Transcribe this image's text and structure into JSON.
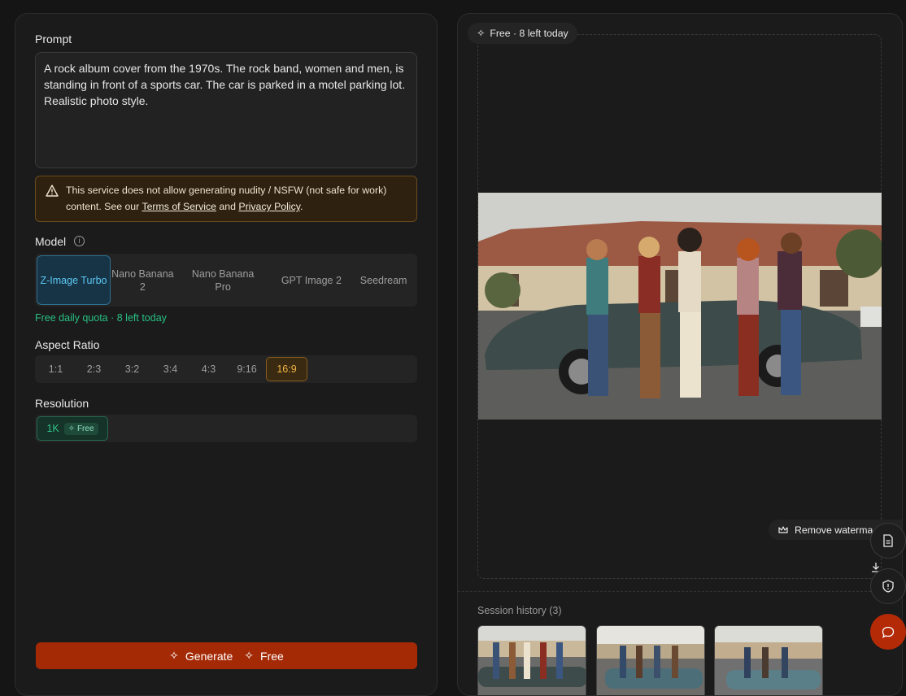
{
  "prompt": {
    "label": "Prompt",
    "value": "A rock album cover from the 1970s. The rock band, women and men, is standing in front of a sports car. The car is parked in a motel parking lot. Realistic photo style."
  },
  "warning": {
    "text_before": "This service does not allow generating nudity / NSFW (not safe for work) content. See our ",
    "terms_link": "Terms of Service",
    "and": " and ",
    "privacy_link": "Privacy Policy",
    "end": "."
  },
  "model": {
    "label": "Model",
    "info_icon": "info-icon",
    "options": [
      "Z-Image Turbo",
      "Nano Banana 2",
      "Nano Banana Pro",
      "GPT Image 2",
      "Seedream"
    ],
    "selected": "Z-Image Turbo"
  },
  "quota_text": "Free daily quota · 8 left today",
  "aspect_ratio": {
    "label": "Aspect Ratio",
    "options": [
      "1:1",
      "2:3",
      "3:2",
      "3:4",
      "4:3",
      "9:16",
      "16:9"
    ],
    "selected": "16:9"
  },
  "resolution": {
    "label": "Resolution",
    "option": "1K",
    "badge": "Free"
  },
  "generate": {
    "label": "Generate",
    "badge": "Free"
  },
  "preview": {
    "free_pill": "Free · 8 left today",
    "remove_watermark": "Remove waterma"
  },
  "history": {
    "label": "Session history (3)"
  },
  "colors": {
    "accent_red": "#a42a06",
    "model_active": "#5cc8f2",
    "ratio_active": "#f3b545",
    "free_green": "#27c084"
  }
}
